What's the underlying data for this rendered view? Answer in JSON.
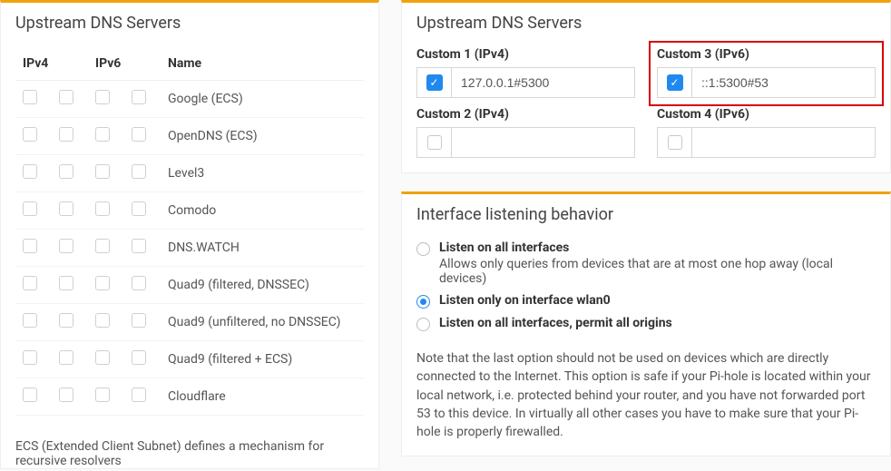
{
  "left": {
    "title": "Upstream DNS Servers",
    "headers": {
      "ipv4": "IPv4",
      "ipv6": "IPv6",
      "name": "Name"
    },
    "providers": [
      {
        "name": "Google (ECS)"
      },
      {
        "name": "OpenDNS (ECS)"
      },
      {
        "name": "Level3"
      },
      {
        "name": "Comodo"
      },
      {
        "name": "DNS.WATCH"
      },
      {
        "name": "Quad9 (filtered, DNSSEC)"
      },
      {
        "name": "Quad9 (unfiltered, no DNSSEC)"
      },
      {
        "name": "Quad9 (filtered + ECS)"
      },
      {
        "name": "Cloudflare"
      }
    ],
    "ecs_note": "ECS (Extended Client Subnet) defines a mechanism for recursive resolvers"
  },
  "right_dns": {
    "title": "Upstream DNS Servers",
    "custom": [
      {
        "label": "Custom 1 (IPv4)",
        "checked": true,
        "value": "127.0.0.1#5300"
      },
      {
        "label": "Custom 3 (IPv6)",
        "checked": true,
        "value": "::1:5300#53",
        "highlight": true
      },
      {
        "label": "Custom 2 (IPv4)",
        "checked": false,
        "value": ""
      },
      {
        "label": "Custom 4 (IPv6)",
        "checked": false,
        "value": ""
      }
    ]
  },
  "interface": {
    "title": "Interface listening behavior",
    "options": [
      {
        "label": "Listen on all interfaces",
        "desc": "Allows only queries from devices that are at most one hop away (local devices)",
        "selected": false
      },
      {
        "label": "Listen only on interface wlan0",
        "desc": "",
        "selected": true
      },
      {
        "label": "Listen on all interfaces, permit all origins",
        "desc": "",
        "selected": false
      }
    ],
    "note": "Note that the last option should not be used on devices which are directly connected to the Internet. This option is safe if your Pi-hole is located within your local network, i.e. protected behind your router, and you have not forwarded port 53 to this device. In virtually all other cases you have to make sure that your Pi-hole is properly firewalled."
  }
}
